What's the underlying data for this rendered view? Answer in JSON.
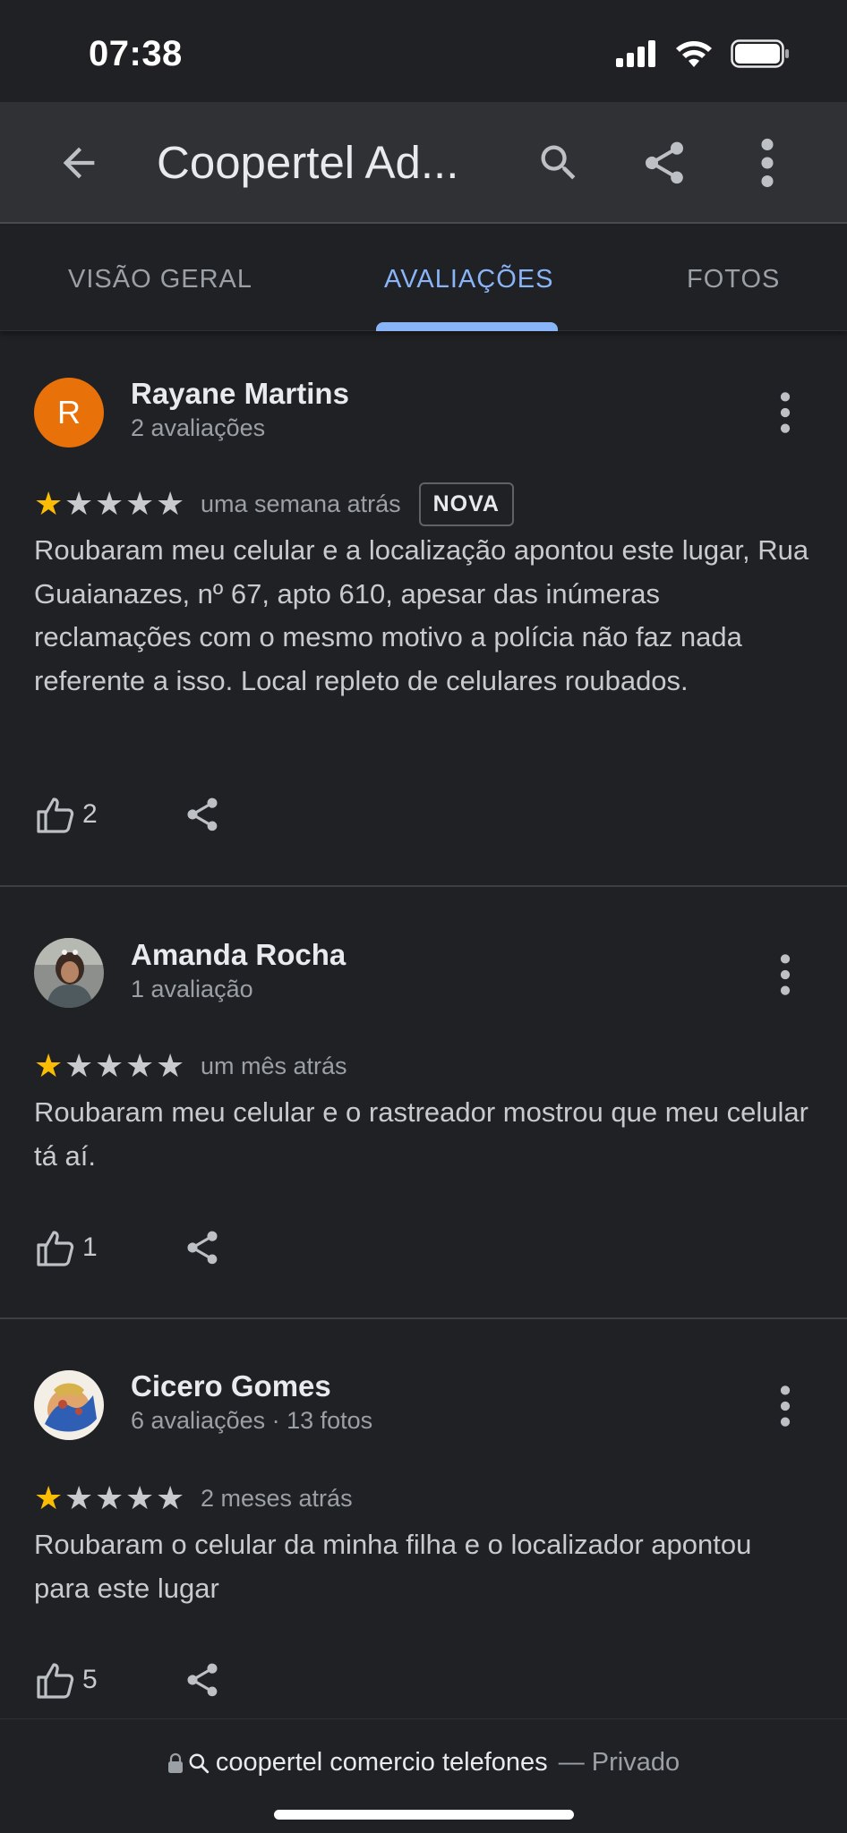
{
  "status_bar": {
    "time": "07:38"
  },
  "app_bar": {
    "title": "Coopertel Ad..."
  },
  "tabs": [
    {
      "label": "VISÃO GERAL",
      "active": false
    },
    {
      "label": "AVALIAÇÕES",
      "active": true
    },
    {
      "label": "FOTOS",
      "active": false
    }
  ],
  "reviews": [
    {
      "avatar_letter": "R",
      "name": "Rayane Martins",
      "meta": "2 avaliações",
      "rating": 1,
      "time": "uma semana atrás",
      "badge": "NOVA",
      "text": "Roubaram meu celular e a localização apontou este lugar, Rua Guaianazes, nº 67, apto 610, apesar das inúmeras reclamações com o mesmo motivo a polícia não faz nada referente a isso. Local repleto de celulares roubados.",
      "likes": "2"
    },
    {
      "name": "Amanda Rocha",
      "meta": "1 avaliação",
      "rating": 1,
      "time": "um mês atrás",
      "text": "Roubaram meu celular e o rastreador mostrou que meu celular tá aí.",
      "likes": "1"
    },
    {
      "name": "Cicero Gomes",
      "meta": "6 avaliações · 13 fotos",
      "rating": 1,
      "time": "2 meses atrás",
      "text": "Roubaram o celular da minha filha e o localizador apontou para este lugar",
      "likes": "5"
    }
  ],
  "browser_bar": {
    "host": "coopertel comercio telefones",
    "mode": "— Privado"
  },
  "colors": {
    "background": "#202124",
    "app_bar": "#303134",
    "accent_blue": "#8ab4f8",
    "star_yellow": "#fbbc04",
    "avatar_orange": "#e8710a"
  },
  "icons": [
    "back-arrow-icon",
    "search-icon",
    "share-icon",
    "more-vert-icon",
    "thumb-up-icon",
    "lock-icon",
    "signal-icon",
    "wifi-icon",
    "battery-icon"
  ]
}
